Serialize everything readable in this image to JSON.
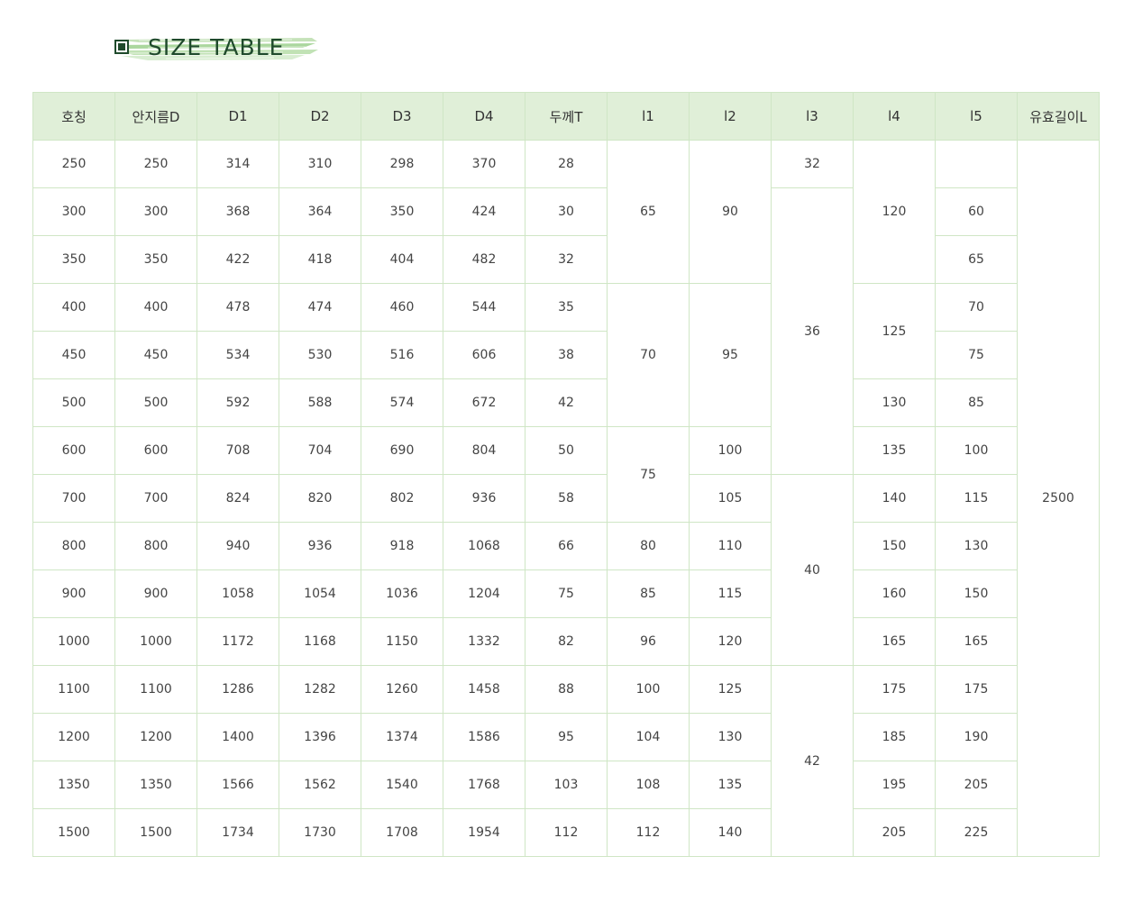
{
  "title": "SIZE TABLE",
  "headers": [
    "호칭",
    "안지름D",
    "D1",
    "D2",
    "D3",
    "D4",
    "두께T",
    "l1",
    "l2",
    "l3",
    "l4",
    "l5",
    "유효길이L"
  ],
  "rows": [
    [
      "250",
      "250",
      "314",
      "310",
      "298",
      "370",
      "28"
    ],
    [
      "300",
      "300",
      "368",
      "364",
      "350",
      "424",
      "30"
    ],
    [
      "350",
      "350",
      "422",
      "418",
      "404",
      "482",
      "32"
    ],
    [
      "400",
      "400",
      "478",
      "474",
      "460",
      "544",
      "35"
    ],
    [
      "450",
      "450",
      "534",
      "530",
      "516",
      "606",
      "38"
    ],
    [
      "500",
      "500",
      "592",
      "588",
      "574",
      "672",
      "42"
    ],
    [
      "600",
      "600",
      "708",
      "704",
      "690",
      "804",
      "50"
    ],
    [
      "700",
      "700",
      "824",
      "820",
      "802",
      "936",
      "58"
    ],
    [
      "800",
      "800",
      "940",
      "936",
      "918",
      "1068",
      "66"
    ],
    [
      "900",
      "900",
      "1058",
      "1054",
      "1036",
      "1204",
      "75"
    ],
    [
      "1000",
      "1000",
      "1172",
      "1168",
      "1150",
      "1332",
      "82"
    ],
    [
      "1100",
      "1100",
      "1286",
      "1282",
      "1260",
      "1458",
      "88"
    ],
    [
      "1200",
      "1200",
      "1400",
      "1396",
      "1374",
      "1586",
      "95"
    ],
    [
      "1350",
      "1350",
      "1566",
      "1562",
      "1540",
      "1768",
      "103"
    ],
    [
      "1500",
      "1500",
      "1734",
      "1730",
      "1708",
      "1954",
      "112"
    ]
  ],
  "merged": {
    "l1": [
      [
        "65",
        0,
        3
      ],
      [
        "70",
        3,
        3
      ],
      [
        "75",
        6,
        2
      ],
      [
        "80",
        8,
        1
      ],
      [
        "85",
        9,
        1
      ],
      [
        "96",
        10,
        1
      ],
      [
        "100",
        11,
        1
      ],
      [
        "104",
        12,
        1
      ],
      [
        "108",
        13,
        1
      ],
      [
        "112",
        14,
        1
      ]
    ],
    "l2": [
      [
        "90",
        0,
        3
      ],
      [
        "95",
        3,
        3
      ],
      [
        "100",
        6,
        1
      ],
      [
        "105",
        7,
        1
      ],
      [
        "110",
        8,
        1
      ],
      [
        "115",
        9,
        1
      ],
      [
        "120",
        10,
        1
      ],
      [
        "125",
        11,
        1
      ],
      [
        "130",
        12,
        1
      ],
      [
        "135",
        13,
        1
      ],
      [
        "140",
        14,
        1
      ]
    ],
    "l3": [
      [
        "32",
        0,
        1
      ],
      [
        "36",
        1,
        6
      ],
      [
        "40",
        7,
        4
      ],
      [
        "42",
        11,
        4
      ]
    ],
    "l4": [
      [
        "120",
        0,
        3
      ],
      [
        "125",
        3,
        2
      ],
      [
        "130",
        5,
        1
      ],
      [
        "135",
        6,
        1
      ],
      [
        "140",
        7,
        1
      ],
      [
        "150",
        8,
        1
      ],
      [
        "160",
        9,
        1
      ],
      [
        "165",
        10,
        1
      ],
      [
        "175",
        11,
        1
      ],
      [
        "185",
        12,
        1
      ],
      [
        "195",
        13,
        1
      ],
      [
        "205",
        14,
        1
      ]
    ],
    "l5": [
      [
        "",
        0,
        1
      ],
      [
        "60",
        1,
        1
      ],
      [
        "65",
        2,
        1
      ],
      [
        "70",
        3,
        1
      ],
      [
        "75",
        4,
        1
      ],
      [
        "85",
        5,
        1
      ],
      [
        "100",
        6,
        1
      ],
      [
        "115",
        7,
        1
      ],
      [
        "130",
        8,
        1
      ],
      [
        "150",
        9,
        1
      ],
      [
        "165",
        10,
        1
      ],
      [
        "175",
        11,
        1
      ],
      [
        "190",
        12,
        1
      ],
      [
        "205",
        13,
        1
      ],
      [
        "225",
        14,
        1
      ]
    ],
    "L": [
      [
        "2500",
        0,
        15
      ]
    ]
  }
}
